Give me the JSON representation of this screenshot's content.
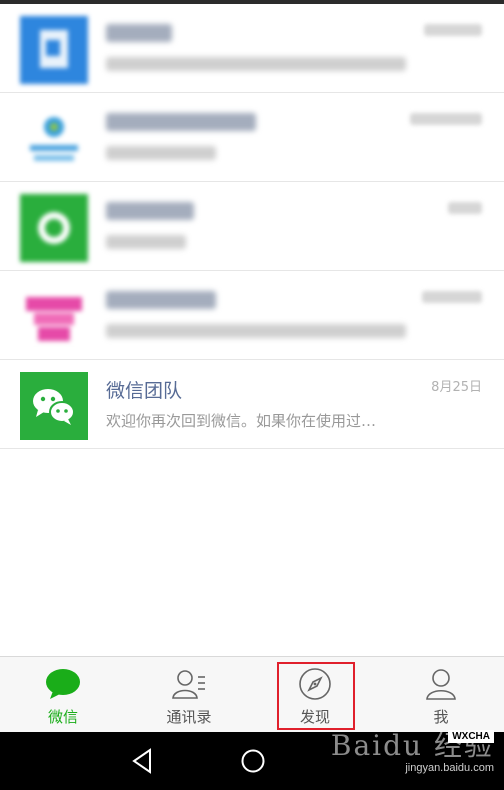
{
  "chats": [
    {
      "name": "",
      "preview": "",
      "time": "",
      "avatar": "subscription-avatar",
      "avatar_color": "#2e86de",
      "blurred": true
    },
    {
      "name": "",
      "preview": "",
      "time": "",
      "avatar": "china-mobile-avatar",
      "avatar_color": "#4aa3df",
      "blurred": true
    },
    {
      "name": "",
      "preview": "",
      "time": "",
      "avatar": "wechat-pay-avatar",
      "avatar_color": "#2aae3d",
      "blurred": true
    },
    {
      "name": "",
      "preview": "",
      "time": "",
      "avatar": "pink-avatar",
      "avatar_color": "#e64aa8",
      "blurred": true
    },
    {
      "name": "微信团队",
      "preview": "欢迎你再次回到微信。如果你在使用过…",
      "time": "8月25日",
      "avatar": "wechat-team-avatar",
      "avatar_color": "#2aae3d",
      "blurred": false
    }
  ],
  "tabbar": {
    "tabs": [
      {
        "label": "微信",
        "icon": "chat-bubble-icon",
        "active": true
      },
      {
        "label": "通讯录",
        "icon": "contacts-icon",
        "active": false
      },
      {
        "label": "发现",
        "icon": "compass-icon",
        "active": false,
        "highlighted": true
      },
      {
        "label": "我",
        "icon": "person-icon",
        "active": false
      }
    ]
  },
  "colors": {
    "accent": "#1aad19",
    "name_blue": "#576b95",
    "highlight_red": "#e0202c"
  },
  "watermark": {
    "logo_text": "Baidu 经验",
    "url": "jingyan.baidu.com",
    "badge": "WXCHA"
  }
}
